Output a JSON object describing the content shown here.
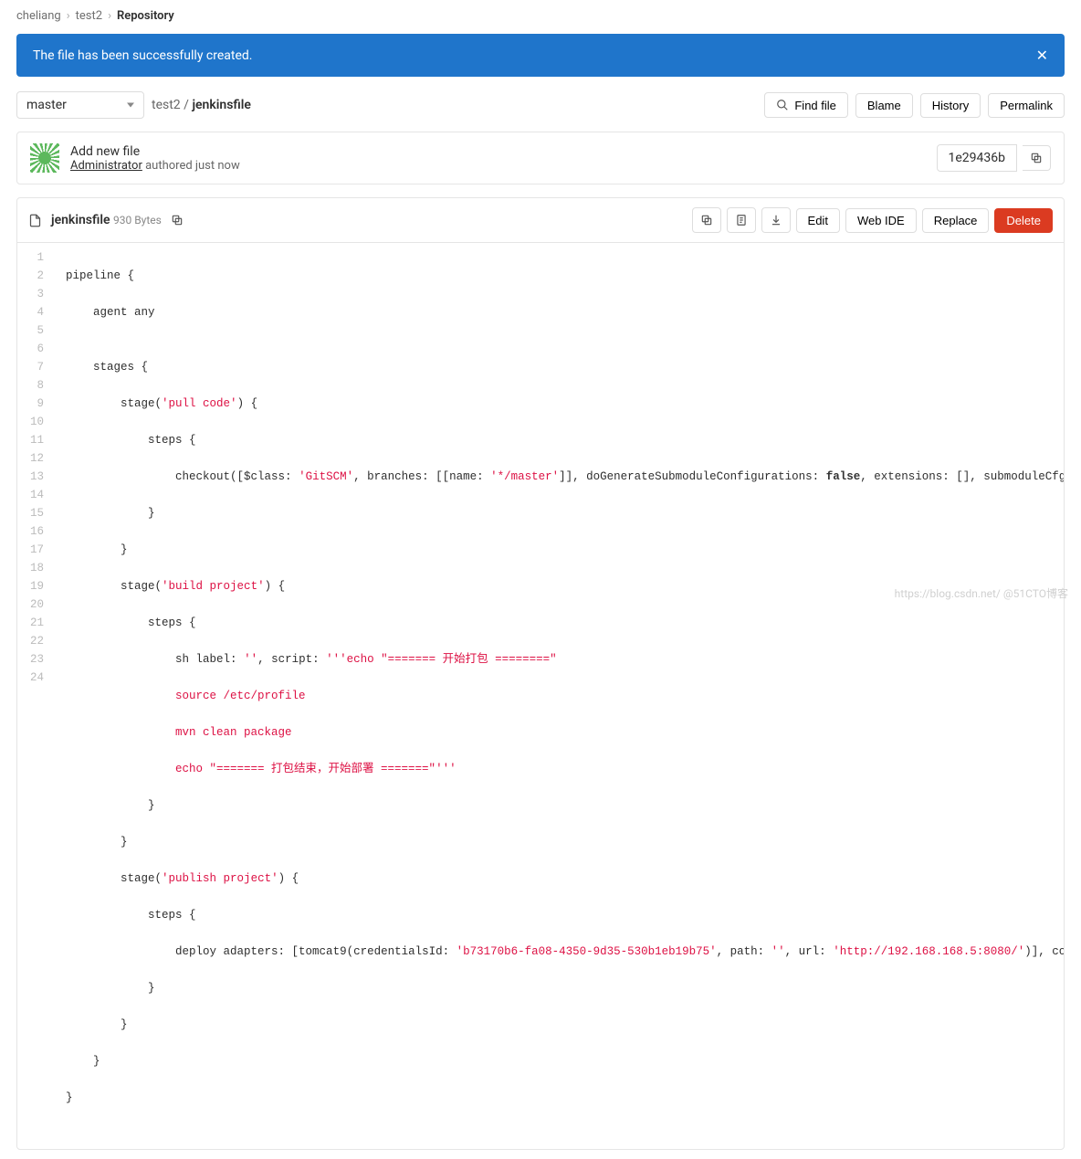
{
  "breadcrumbs": {
    "owner": "cheliang",
    "project": "test2",
    "section": "Repository"
  },
  "alert": {
    "text": "The file has been successfully created."
  },
  "branch": {
    "current": "master"
  },
  "path": {
    "project": "test2",
    "sep": "/",
    "file": "jenkinsfile"
  },
  "actions": {
    "find_file": "Find file",
    "blame": "Blame",
    "history": "History",
    "permalink": "Permalink"
  },
  "commit": {
    "title": "Add new file",
    "author": "Administrator",
    "authored": "authored just now",
    "sha_short": "1e29436b"
  },
  "file": {
    "name": "jenkinsfile",
    "size": "930 Bytes",
    "edit": "Edit",
    "webide": "Web IDE",
    "replace": "Replace",
    "delete": "Delete"
  },
  "code": {
    "lines": "24",
    "ln_indent": "    ",
    "l1_a": "pipeline {",
    "l2_a": "    agent any",
    "l3_a": "",
    "l4_a": "    stages {",
    "l5_a": "        stage(",
    "l5_s": "'pull code'",
    "l5_b": ") {",
    "l6_a": "            steps {",
    "l7_a": "                checkout([$class: ",
    "l7_s1": "'GitSCM'",
    "l7_b": ", branches: [[name: ",
    "l7_s2": "'*/master'",
    "l7_c": "]], doGenerateSubmoduleConfigurations: ",
    "l7_kw": "false",
    "l7_d": ", extensions: [], submoduleCfg: [], user",
    "l8_a": "            }",
    "l9_a": "        }",
    "l10_a": "        stage(",
    "l10_s": "'build project'",
    "l10_b": ") {",
    "l11_a": "            steps {",
    "l12_a": "                sh label: ",
    "l12_s1": "''",
    "l12_b": ", script: ",
    "l12_s2": "'''echo \"======= 开始打包 ========\"",
    "l13_s": "                source /etc/profile",
    "l14_s": "                mvn clean package",
    "l15_s": "                echo \"======= 打包结束，开始部署 =======\"'''",
    "l16_a": "            }",
    "l17_a": "        }",
    "l18_a": "        stage(",
    "l18_s": "'publish project'",
    "l18_b": ") {",
    "l19_a": "            steps {",
    "l20_a": "                deploy adapters: [tomcat9(credentialsId: ",
    "l20_s1": "'b73170b6-fa08-4350-9d35-530b1eb19b75'",
    "l20_b": ", path: ",
    "l20_s2": "''",
    "l20_c": ", url: ",
    "l20_s3": "'http://192.168.168.5:8080/'",
    "l20_d": ")], contextPath:",
    "l21_a": "            }",
    "l22_a": "        }",
    "l23_a": "    }",
    "l24_a": "}"
  },
  "watermark": "https://blog.csdn.net/ @51CTO博客"
}
